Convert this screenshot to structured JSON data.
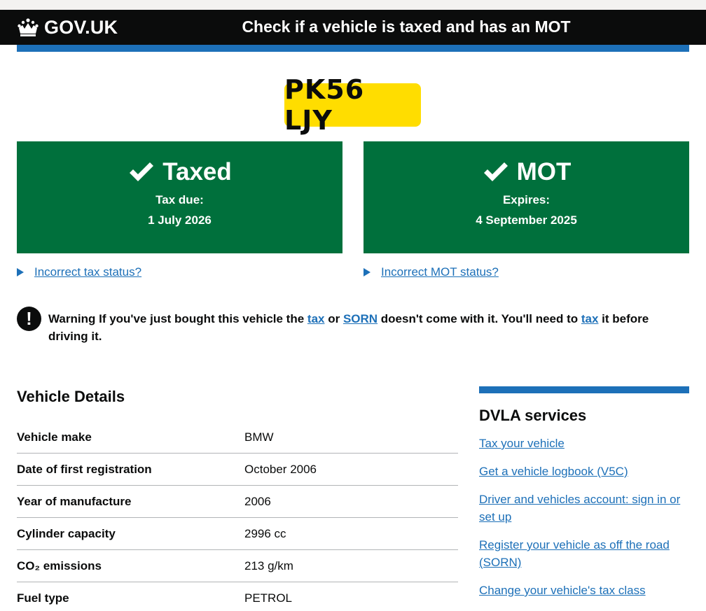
{
  "header": {
    "logo_text": "GOV.UK",
    "service_name": "Check if a vehicle is taxed and has an MOT"
  },
  "vehicle": {
    "registration": "PK56 LJY"
  },
  "tax_status": {
    "title": "Taxed",
    "label": "Tax due:",
    "date": "1 July 2026",
    "details_link": "Incorrect tax status?"
  },
  "mot_status": {
    "title": "MOT",
    "label": "Expires:",
    "date": "4 September 2025",
    "details_link": "Incorrect MOT status?"
  },
  "warning": {
    "icon": "!",
    "prefix": "Warning",
    "text_1": " If you've just bought this vehicle the ",
    "link_tax_1": "tax",
    "text_2": " or ",
    "link_sorn": "SORN",
    "text_3": " doesn't come with it. You'll need to ",
    "link_tax_2": "tax",
    "text_4": " it before driving it."
  },
  "vehicle_details": {
    "heading": "Vehicle Details",
    "rows": [
      {
        "key": "Vehicle make",
        "value": "BMW"
      },
      {
        "key": "Date of first registration",
        "value": "October 2006"
      },
      {
        "key": "Year of manufacture",
        "value": "2006"
      },
      {
        "key": "Cylinder capacity",
        "value": "2996 cc"
      },
      {
        "key": "CO₂ emissions",
        "value": "213 g/km"
      },
      {
        "key": "Fuel type",
        "value": "PETROL"
      }
    ]
  },
  "dvla_services": {
    "heading": "DVLA services",
    "links": [
      "Tax your vehicle",
      "Get a vehicle logbook (V5C)",
      "Driver and vehicles account: sign in or set up",
      "Register your vehicle as off the road (SORN)",
      "Change your vehicle's tax class"
    ]
  },
  "colors": {
    "header_bg": "#0b0c0c",
    "accent_blue": "#1d70b8",
    "status_green": "#00703c",
    "plate_yellow": "#ffdd00"
  }
}
